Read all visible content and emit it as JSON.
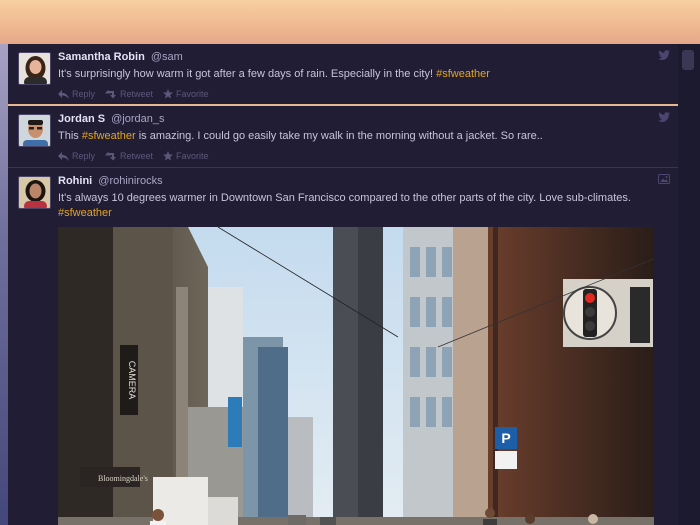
{
  "tweets": [
    {
      "name": "Samantha Robin",
      "handle": "@sam",
      "text_before": "It's surprisingly how warm it got after a few days of rain. Especially in the city! ",
      "hashtag": "#sfweather",
      "text_after": "",
      "reply": "Reply",
      "retweet": "Retweet",
      "favorite": "Favorite",
      "corner_icon": "bird-icon"
    },
    {
      "name": "Jordan S",
      "handle": "@jordan_s",
      "text_before": "This ",
      "hashtag": "#sfweather",
      "text_after": " is amazing. I could go easily take my walk in the morning without a jacket. So rare..",
      "reply": "Reply",
      "retweet": "Retweet",
      "favorite": "Favorite",
      "corner_icon": "bird-icon"
    },
    {
      "name": "Rohini",
      "handle": "@rohinirocks",
      "text_before": "It's always 10 degrees warmer in Downtown San Francisco compared to the other parts of the city. Love sub-climates. ",
      "hashtag": "#sfweather",
      "text_after": "",
      "corner_icon": "image-icon",
      "photo_signs": {
        "camera": "CAMERA",
        "parking": "P",
        "store": "Bloomingdale's"
      }
    }
  ],
  "colors": {
    "panel": "#211d35",
    "hashtag": "#e3a520",
    "accent_border": "#e8b690"
  }
}
